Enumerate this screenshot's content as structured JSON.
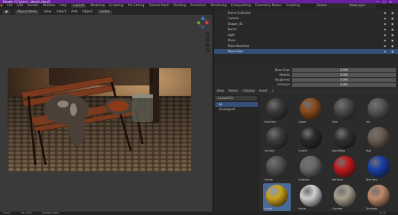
{
  "window": {
    "title": "Blender [C:\\Users\\...\\bench.blend]",
    "controls": [
      "—",
      "□",
      "✕"
    ]
  },
  "menu": {
    "items": [
      "File",
      "Edit",
      "Render",
      "Window",
      "Help"
    ],
    "workspaces": [
      "Layout",
      "Modeling",
      "Sculpting",
      "UV Editing",
      "Texture Paint",
      "Shading",
      "Animation",
      "Rendering",
      "Compositing",
      "Geometry Nodes",
      "Scripting"
    ],
    "active_workspace": "Layout",
    "scene": "Scene",
    "view_layer": "ViewLayer"
  },
  "viewport": {
    "mode": "Object Mode",
    "menus": [
      "View",
      "Select",
      "Add",
      "Object"
    ],
    "shading": "Global"
  },
  "outliner": {
    "rows": [
      {
        "label": "Scene Collection",
        "selected": false
      },
      {
        "label": "Camera",
        "selected": false
      },
      {
        "label": "Dragon_01",
        "selected": false
      },
      {
        "label": "Bench",
        "selected": false
      },
      {
        "label": "Light",
        "selected": false
      },
      {
        "label": "Plane",
        "selected": false
      },
      {
        "label": "Plane Backdrop",
        "selected": false
      },
      {
        "label": "Plane Floor",
        "selected": true
      }
    ]
  },
  "properties": {
    "rows": [
      {
        "label": "Base Color",
        "value": "0.000"
      },
      {
        "label": "Metallic",
        "value": "0.000"
      },
      {
        "label": "Roughness",
        "value": "0.000"
      },
      {
        "label": "Emission",
        "value": "0.000"
      }
    ]
  },
  "asset_browser": {
    "header": [
      "View",
      "Select",
      "Catalog",
      "Asset"
    ],
    "library": "Current File",
    "catalogs": [
      {
        "label": "All",
        "selected": true
      },
      {
        "label": "Unassigned",
        "selected": false
      }
    ],
    "assets": [
      {
        "label": "Metal Dark",
        "color": "#3a3a3a"
      },
      {
        "label": "Copper",
        "color": "#8a4a1c"
      },
      {
        "label": "Steel",
        "color": "#4a4a4a"
      },
      {
        "label": "Iron",
        "color": "#555555"
      },
      {
        "label": "Car Paint",
        "color": "#3c3c3c"
      },
      {
        "label": "Chrome",
        "color": "#2a2a2a"
      },
      {
        "label": "Black Metal",
        "color": "#303030"
      },
      {
        "label": "Rust",
        "color": "#6a5a50"
      },
      {
        "label": "Granite",
        "color": "#505050"
      },
      {
        "label": "Scratched",
        "color": "#686868"
      },
      {
        "label": "Red Paint",
        "color": "#c01a1a"
      },
      {
        "label": "Blue Paint",
        "color": "#1a3fa8"
      },
      {
        "label": "Hazard",
        "color": "#c9a01a"
      },
      {
        "label": "Plaster",
        "color": "#cfcfcf"
      },
      {
        "label": "Concrete",
        "color": "#a89e8e"
      },
      {
        "label": "Terracotta",
        "color": "#c08a6a"
      }
    ],
    "selected_index": 12
  },
  "status": {
    "items": [
      "Select",
      "Pan View",
      "Context Menu"
    ],
    "version": "3.2.0"
  },
  "colors": {
    "accent": "#6a1fa0",
    "selection": "#345078"
  }
}
